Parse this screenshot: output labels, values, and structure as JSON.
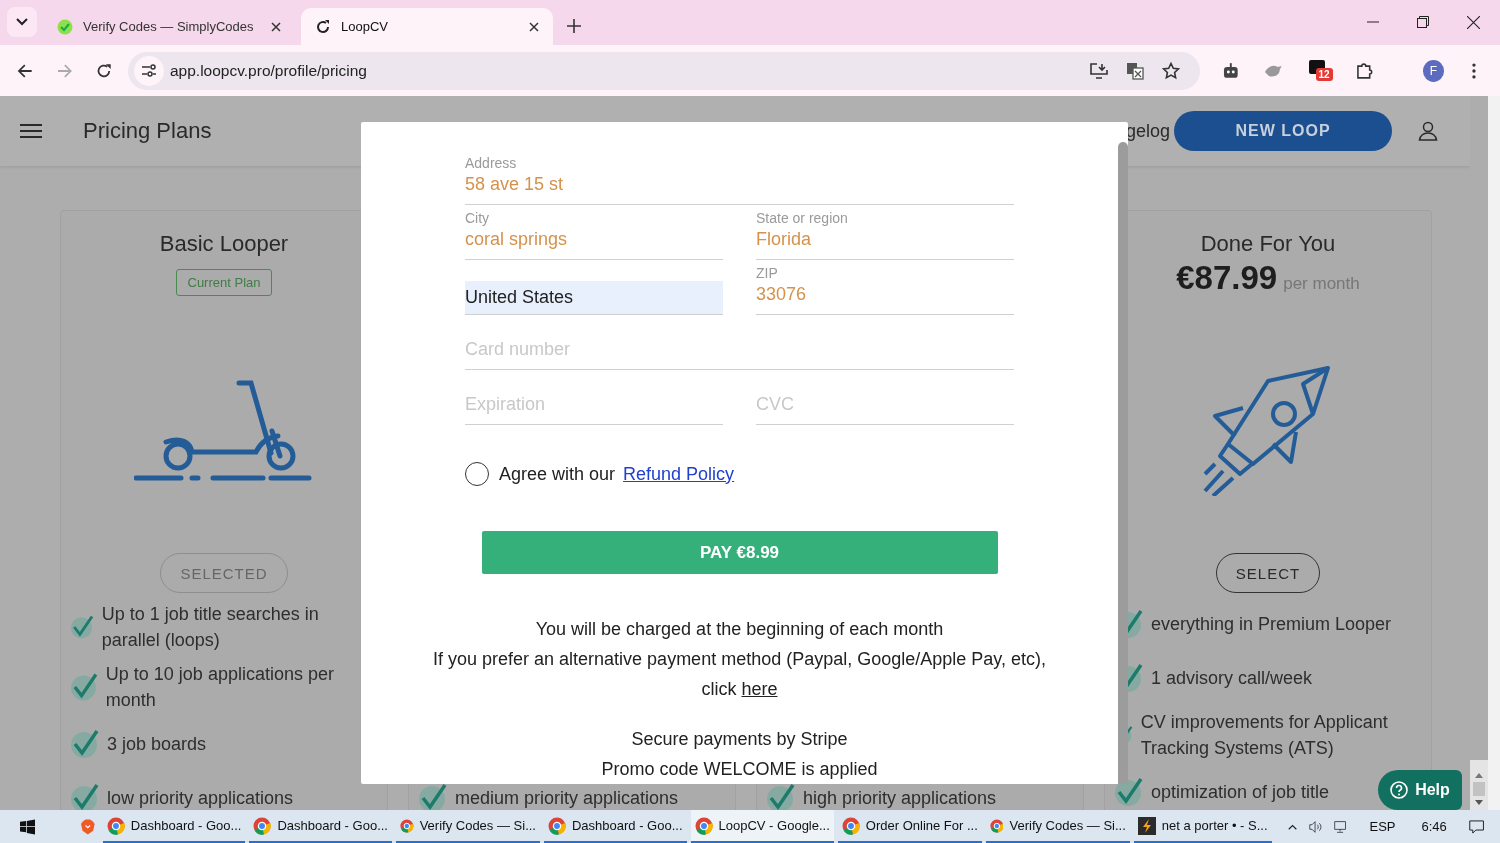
{
  "browser": {
    "tabs": [
      {
        "title": "Verify Codes — SimplyCodes",
        "selected": false
      },
      {
        "title": "LoopCV",
        "selected": true
      }
    ],
    "url": "app.loopcv.pro/profile/pricing",
    "forward_disabled": true,
    "extension_badge": "12",
    "profile_initial": "F"
  },
  "header": {
    "title": "Pricing Plans",
    "partial_link": "gelog",
    "button": "NEW LOOP"
  },
  "plans": [
    {
      "kind": "scooter",
      "title": "Basic Looper",
      "badge": "Current Plan",
      "button": {
        "label": "SELECTED",
        "disabled": true
      },
      "features": [
        "Up to 1 job title searches in parallel (loops)",
        "Up to 10 job applications per month",
        "3 job boards",
        "low priority applications"
      ]
    },
    {
      "kind": "obscured",
      "features": [
        "medium priority applications"
      ]
    },
    {
      "kind": "obscured",
      "features": [
        "high priority applications"
      ]
    },
    {
      "kind": "rocket",
      "title": "Done For You",
      "price": "€87.99",
      "period": "per month",
      "button": {
        "label": "SELECT",
        "disabled": false
      },
      "features": [
        "everything in Premium Looper",
        "1 advisory call/week",
        "CV improvements for Applicant Tracking Systems (ATS)",
        "optimization of job title"
      ]
    }
  ],
  "modal": {
    "rows": [
      {
        "fields": [
          {
            "label": "Address",
            "value": "58 ave 15 st"
          }
        ]
      },
      {
        "fields": [
          {
            "label": "City",
            "value": "coral springs"
          },
          {
            "label": "State or region",
            "value": "Florida"
          }
        ]
      },
      {
        "fields": [
          {
            "value": "United States",
            "autofilled": true
          },
          {
            "label": "ZIP",
            "value": "33076"
          }
        ]
      },
      {
        "fields": [
          {
            "placeholder": "Card number"
          }
        ]
      },
      {
        "fields": [
          {
            "placeholder": "Expiration"
          },
          {
            "placeholder": "CVC"
          }
        ]
      }
    ],
    "agree": {
      "text": "Agree with our",
      "link": "Refund Policy",
      "checked": false
    },
    "pay_button": "PAY €8.99",
    "notes": [
      {
        "lines": [
          {
            "text": "You will be charged at the beginning of each month"
          },
          {
            "text": "If you prefer an alternative payment method (Paypal, Google/Apple Pay, etc),"
          },
          {
            "text": "click",
            "link": "here"
          }
        ]
      },
      {
        "lines": [
          {
            "text": "Secure payments by Stripe"
          },
          {
            "text": "Promo code WELCOME is applied"
          }
        ]
      }
    ]
  },
  "help_button": "Help",
  "taskbar": {
    "items": [
      {
        "label": "Dashboard - Goo...",
        "selected": false
      },
      {
        "label": "Dashboard - Goo...",
        "selected": false
      },
      {
        "label": "Verify Codes — Si...",
        "selected": false
      },
      {
        "label": "Dashboard - Goo...",
        "selected": false
      },
      {
        "label": "LoopCV - Google...",
        "selected": true
      },
      {
        "label": "Order Online For ...",
        "selected": false
      },
      {
        "label": "Verify Codes — Si...",
        "selected": false
      },
      {
        "label": "net a porter • - S...",
        "selected": false,
        "kind": "app"
      }
    ],
    "language": "ESP",
    "time": "6:46"
  }
}
